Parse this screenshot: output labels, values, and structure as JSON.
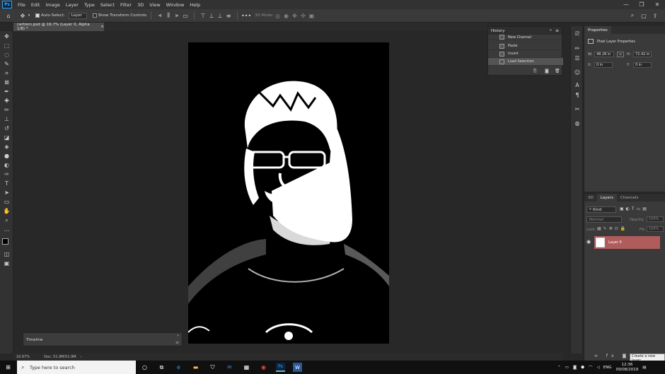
{
  "app": {
    "logo": "Ps"
  },
  "menu": [
    "File",
    "Edit",
    "Image",
    "Layer",
    "Type",
    "Select",
    "Filter",
    "3D",
    "View",
    "Window",
    "Help"
  ],
  "window_controls": [
    "—",
    "❐",
    "✕"
  ],
  "options_bar": {
    "auto_select_label": "Auto-Select:",
    "auto_select_value": "Layer",
    "transform_label": "Show Transform Controls",
    "mode_3d_label": "3D Mode:"
  },
  "document": {
    "tab_title": "cartoon.psd @ 16.7% (Layer 0, Alpha 1/8) *",
    "close": "×",
    "zoom": "16.67%",
    "doc_size": "Doc: 51.9M/51.9M"
  },
  "timeline": {
    "label": "Timeline"
  },
  "history": {
    "title": "History",
    "items": [
      "New Channel",
      "Paste",
      "Invert",
      "Load Selection"
    ]
  },
  "properties": {
    "title": "Properties",
    "subtitle": "Pixel Layer Properties",
    "w_label": "W:",
    "w_value": "48.28 in",
    "h_label": "H:",
    "h_value": "72.42 in",
    "x_label": "X:",
    "x_value": "0 in",
    "y_label": "Y:",
    "y_value": "0 in"
  },
  "layers_panel": {
    "tabs": [
      "3D",
      "Layers",
      "Channels"
    ],
    "kind": "Kind",
    "blend_mode": "Normal",
    "opacity_label": "Opacity:",
    "opacity_value": "100%",
    "lock_label": "Lock:",
    "fill_label": "Fill:",
    "fill_value": "100%",
    "layer_name": "Layer 0",
    "tooltip": "Create a new layer"
  },
  "taskbar": {
    "search_placeholder": "Type here to search",
    "lang": "ENG",
    "time": "12:36",
    "date": "09/08/2019"
  },
  "colors": {
    "accent": "#31a8ff",
    "selected_layer": "#b05c5c",
    "panel_bg": "#3a3a3a"
  }
}
